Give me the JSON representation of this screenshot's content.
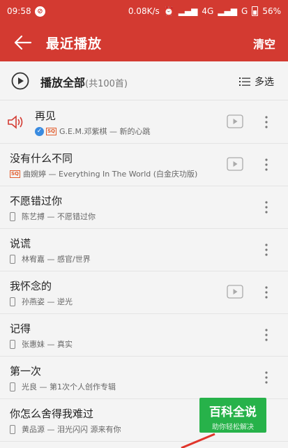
{
  "status_bar": {
    "time": "09:58",
    "network_speed": "0.08K/s",
    "signal_4g": "4G",
    "signal_g": "G",
    "battery": "56%"
  },
  "header": {
    "title": "最近播放",
    "clear_label": "清空"
  },
  "play_all": {
    "label": "播放全部",
    "count": "(共100首)",
    "multi_select_label": "多选"
  },
  "songs": [
    {
      "title": "再见",
      "artist": "G.E.M.邓紫棋",
      "album": "新的心跳"
    },
    {
      "title": "没有什么不同",
      "artist": "曲婉婷",
      "album": "Everything In The World (白金庆功版)"
    },
    {
      "title": "不愿错过你",
      "artist": "陈艺搏",
      "album": "不愿错过你"
    },
    {
      "title": "说谎",
      "artist": "林宥嘉",
      "album": "感官/世界"
    },
    {
      "title": "我怀念的",
      "artist": "孙燕姿",
      "album": "逆光"
    },
    {
      "title": "记得",
      "artist": "张惠妹",
      "album": "真实"
    },
    {
      "title": "第一次",
      "artist": "光良",
      "album": "第1次个人创作专辑"
    },
    {
      "title": "你怎么舍得我难过",
      "artist": "黄品源",
      "album": "泪光闪闪 源来有你"
    }
  ],
  "watermark": {
    "title": "百科全说",
    "subtitle": "助你轻松解决"
  },
  "colors": {
    "brand_red": "#d33a31",
    "watermark_green": "#27b24a",
    "verified_blue": "#3a8be0"
  }
}
